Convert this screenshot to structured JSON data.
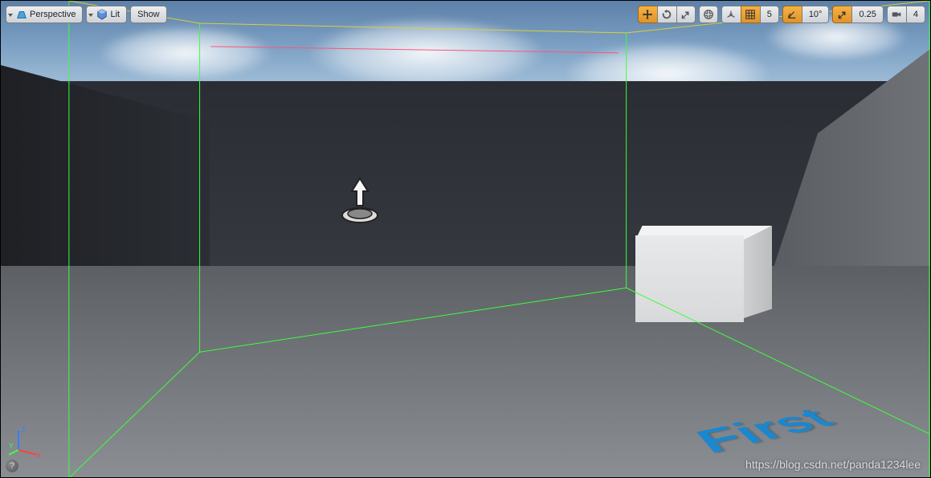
{
  "toolbar_left": {
    "perspective_label": "Perspective",
    "lit_label": "Lit",
    "show_label": "Show"
  },
  "toolbar_right": {
    "grid_snap_value": "5",
    "rotation_snap_value": "10°",
    "scale_snap_value": "0.25",
    "camera_speed_value": "4"
  },
  "floor_text": "First",
  "axis": {
    "x": "X",
    "y": "Y",
    "z": "Z"
  },
  "help_glyph": "?",
  "watermark": "https://blog.csdn.net/panda1234lee"
}
